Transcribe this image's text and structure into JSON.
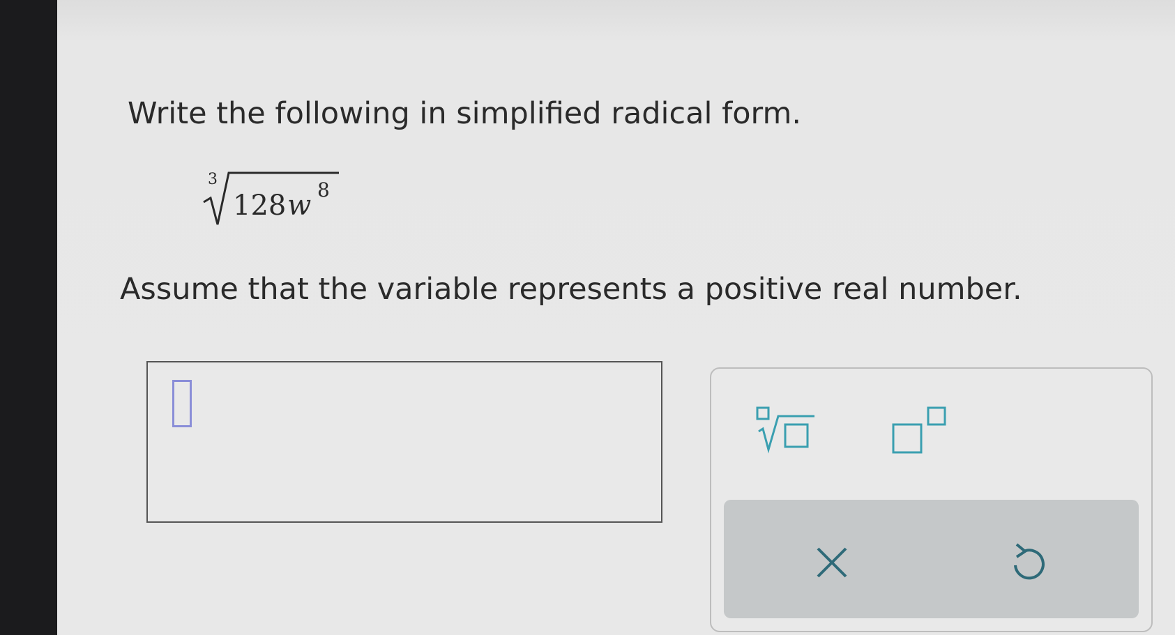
{
  "question": {
    "instruction": "Write the following in simplified radical form.",
    "expression": {
      "index": "3",
      "coefficient": "128",
      "variable": "w",
      "exponent": "8"
    },
    "assumption": "Assume that the variable represents a positive real number."
  },
  "answer": {
    "value": ""
  },
  "toolbar": {
    "buttons": [
      {
        "name": "nth-root",
        "icon": "nth-root-icon"
      },
      {
        "name": "superscript",
        "icon": "superscript-icon"
      }
    ],
    "actions": [
      {
        "name": "clear",
        "icon": "close-icon"
      },
      {
        "name": "undo",
        "icon": "undo-icon"
      }
    ]
  },
  "colors": {
    "accent": "#3a9fb0",
    "cursor": "#8a8ed8",
    "text": "#2a2a2a",
    "action_row": "#c5c8c9"
  }
}
